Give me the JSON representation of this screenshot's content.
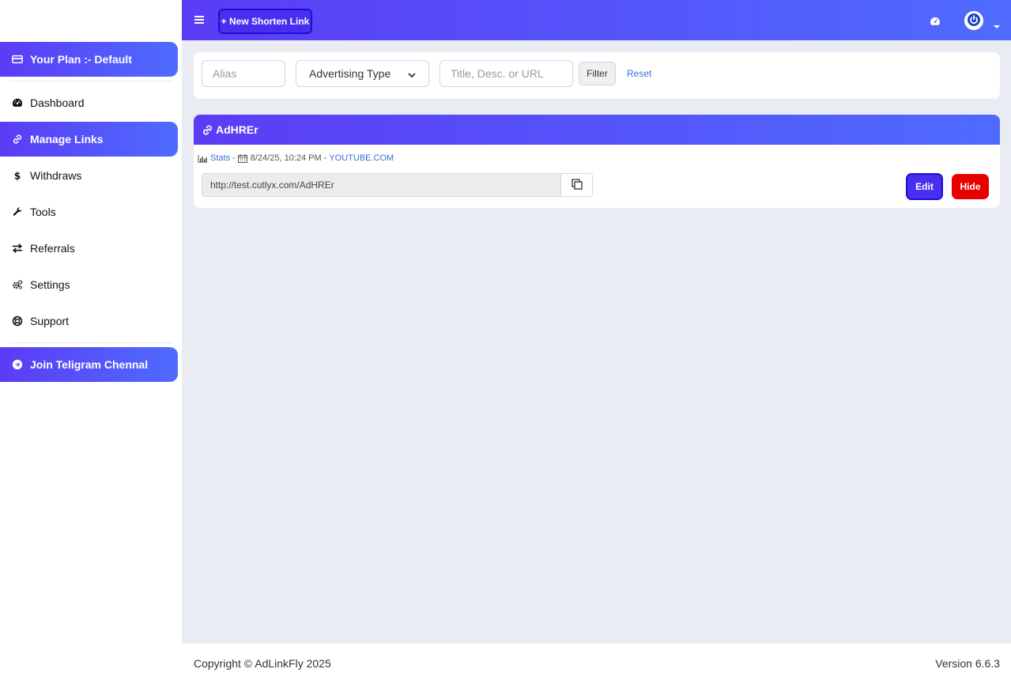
{
  "sidebar": {
    "plan_label": "Your Plan :- Default",
    "items": [
      {
        "label": "Dashboard",
        "icon": "dashboard-icon"
      },
      {
        "label": "Manage Links",
        "icon": "link-icon",
        "active": true
      },
      {
        "label": "Withdraws",
        "icon": "dollar-icon"
      },
      {
        "label": "Tools",
        "icon": "wrench-icon"
      },
      {
        "label": "Referrals",
        "icon": "exchange-icon"
      },
      {
        "label": "Settings",
        "icon": "gears-icon"
      },
      {
        "label": "Support",
        "icon": "lifebuoy-icon"
      }
    ],
    "telegram_label": "Join Teligram Chennal"
  },
  "topbar": {
    "new_link_label": "+ New Shorten Link"
  },
  "filter": {
    "alias_placeholder": "Alias",
    "ad_type_selected": "Advertising Type",
    "search_placeholder": "Title, Desc. or URL",
    "filter_label": "Filter",
    "reset_label": "Reset"
  },
  "link": {
    "alias": "AdHREr",
    "stats_label": "Stats",
    "date": "8/24/25, 10:24 PM",
    "domain": "YOUTUBE.COM",
    "separator": "-",
    "short_url": "http://test.cutlyx.com/AdHREr",
    "edit_label": "Edit",
    "hide_label": "Hide"
  },
  "footer": {
    "copyright": "Copyright © AdLinkFly 2025",
    "version": "Version 6.6.3"
  },
  "colors": {
    "brand_start": "#5b3cf5",
    "brand_end": "#4f6bff",
    "danger": "#e60000",
    "link": "#3a6fd8"
  }
}
